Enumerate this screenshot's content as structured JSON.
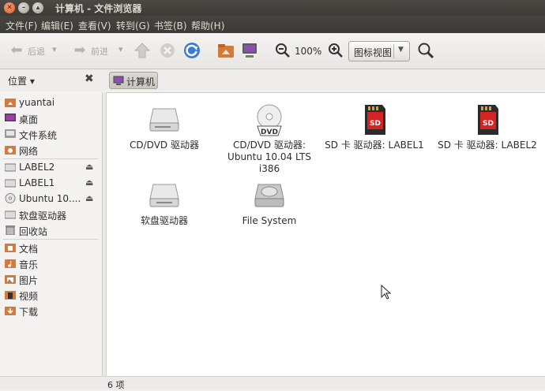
{
  "window": {
    "title": "计算机 - 文件浏览器"
  },
  "menubar": {
    "items": [
      "文件(F)",
      "编辑(E)",
      "查看(V)",
      "转到(G)",
      "书签(B)",
      "帮助(H)"
    ]
  },
  "toolbar": {
    "back": "后退",
    "forward": "前进",
    "zoom": "100%",
    "view_mode": "图标视图"
  },
  "places": {
    "label": "位置 ▾",
    "crumb": "计算机"
  },
  "sidebar": {
    "items": [
      {
        "label": "yuantai",
        "icon": "home-folder-icon",
        "eject": false
      },
      {
        "label": "桌面",
        "icon": "desktop-icon",
        "eject": false
      },
      {
        "label": "文件系统",
        "icon": "filesystem-icon",
        "eject": false
      },
      {
        "label": "网络",
        "icon": "network-icon",
        "eject": false
      },
      {
        "label": "LABEL2",
        "icon": "drive-icon",
        "eject": true
      },
      {
        "label": "LABEL1",
        "icon": "drive-icon",
        "eject": true
      },
      {
        "label": "Ubuntu 10....",
        "icon": "cdrom-icon",
        "eject": true
      },
      {
        "label": "软盘驱动器",
        "icon": "floppy-icon",
        "eject": false
      },
      {
        "label": "回收站",
        "icon": "trash-icon",
        "eject": false
      },
      {
        "label": "文档",
        "icon": "documents-folder-icon",
        "eject": false
      },
      {
        "label": "音乐",
        "icon": "music-folder-icon",
        "eject": false
      },
      {
        "label": "图片",
        "icon": "pictures-folder-icon",
        "eject": false
      },
      {
        "label": "视频",
        "icon": "videos-folder-icon",
        "eject": false
      },
      {
        "label": "下载",
        "icon": "downloads-folder-icon",
        "eject": false
      }
    ]
  },
  "files": [
    {
      "name": "CD/DVD 驱动器",
      "icon": "optical-drive-icon"
    },
    {
      "name": "CD/DVD 驱动器:\nUbuntu 10.04 LTS\ni386",
      "icon": "dvd-disc-icon"
    },
    {
      "name": "SD 卡 驱动器: LABEL1",
      "icon": "sd-card-icon"
    },
    {
      "name": "SD 卡 驱动器: LABEL2",
      "icon": "sd-card-icon"
    },
    {
      "name": "软盘驱动器",
      "icon": "floppy-drive-icon"
    },
    {
      "name": "File System",
      "icon": "harddisk-icon"
    }
  ],
  "status": {
    "text": "6 项"
  },
  "colors": {
    "titlebar": "#3c3b37",
    "accent": "#e15a26",
    "sd_red": "#d32424"
  }
}
